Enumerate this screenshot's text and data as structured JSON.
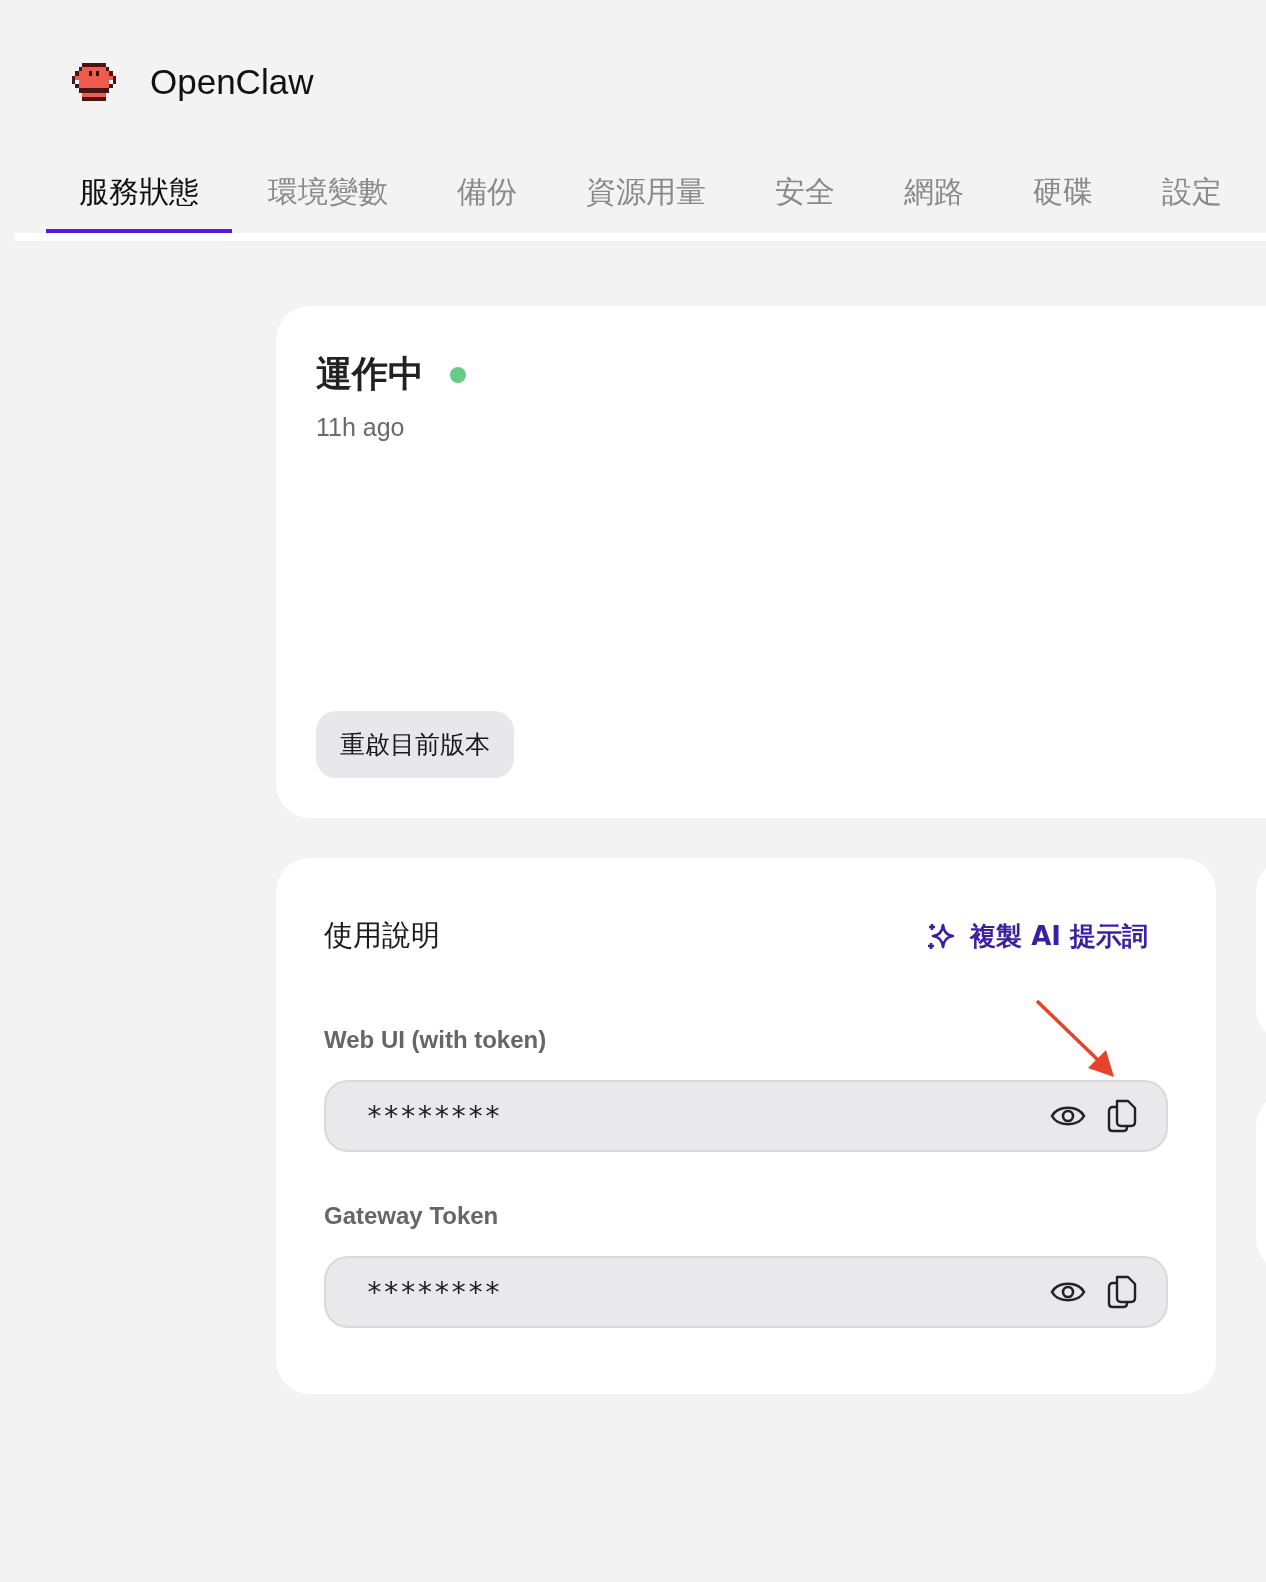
{
  "app": {
    "name": "OpenClaw"
  },
  "tabs": [
    {
      "label": "服務狀態",
      "selected": true
    },
    {
      "label": "環境變數",
      "selected": false
    },
    {
      "label": "備份",
      "selected": false
    },
    {
      "label": "資源用量",
      "selected": false
    },
    {
      "label": "安全",
      "selected": false
    },
    {
      "label": "網路",
      "selected": false
    },
    {
      "label": "硬碟",
      "selected": false
    },
    {
      "label": "設定",
      "selected": false
    }
  ],
  "status_card": {
    "title": "運作中",
    "color": "#66cc88",
    "time": "11h ago",
    "restart_button": "重啟目前版本"
  },
  "instructions": {
    "title": "使用說明",
    "copy_prompt_link": "複製 AI 提示詞",
    "fields": [
      {
        "label": "Web UI (with token)",
        "value": "********",
        "annotated": true
      },
      {
        "label": "Gateway Token",
        "value": "********",
        "annotated": false
      }
    ]
  }
}
